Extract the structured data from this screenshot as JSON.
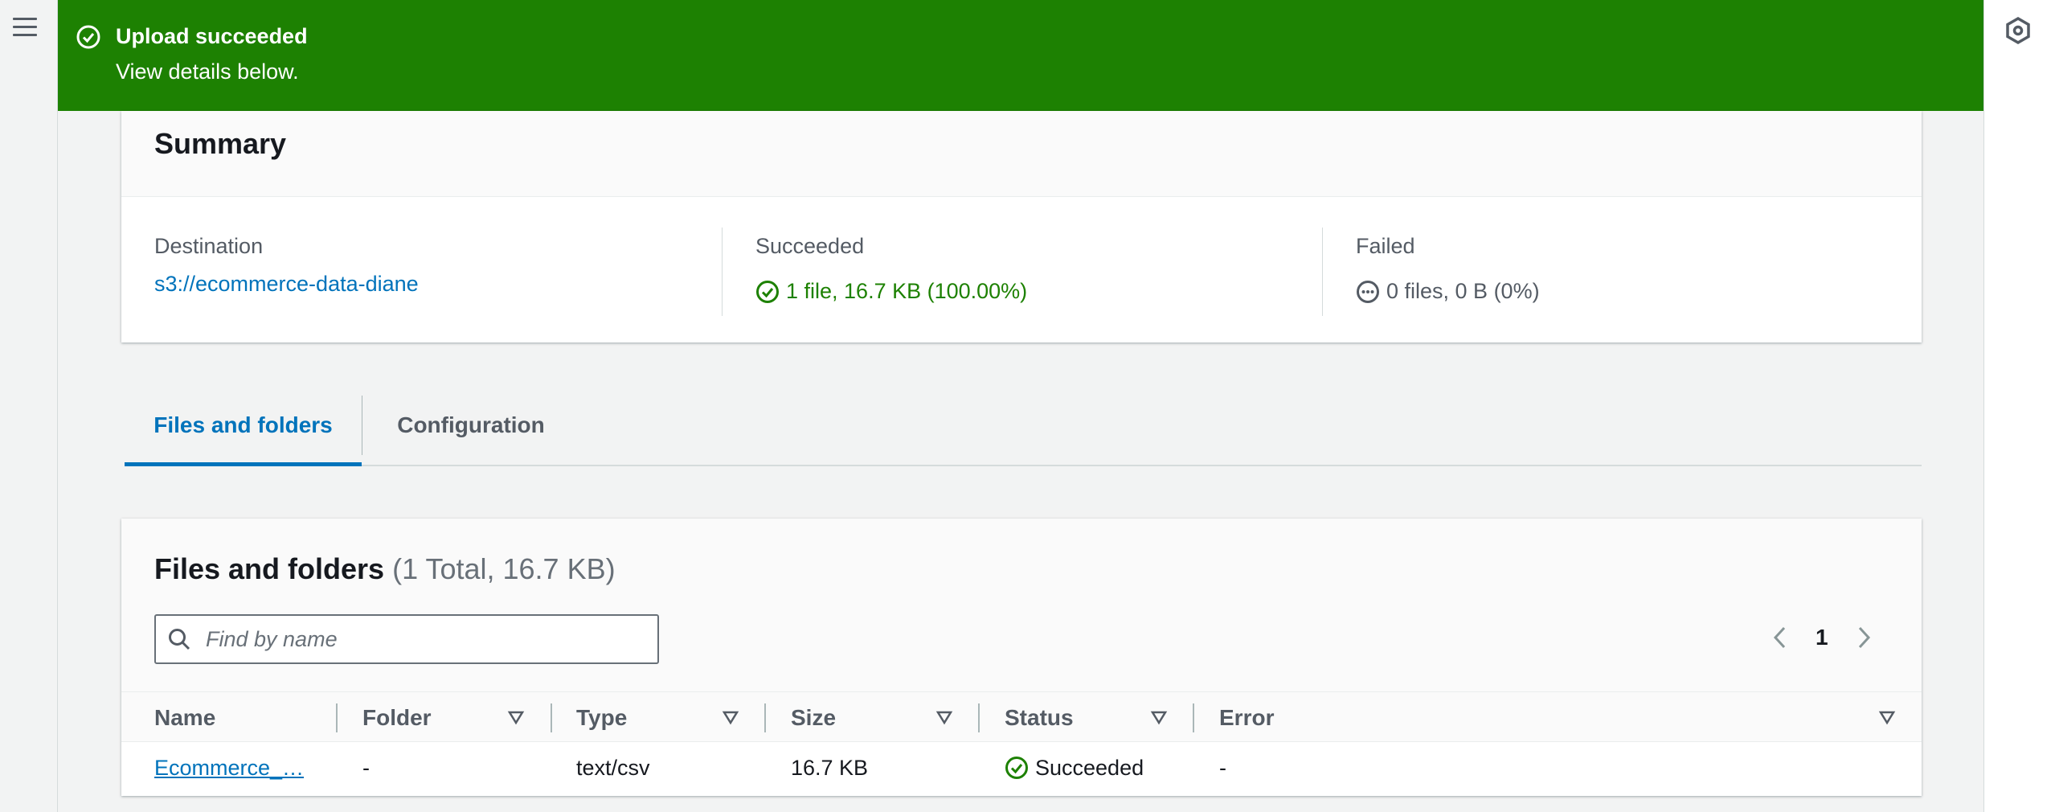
{
  "flash": {
    "title": "Upload succeeded",
    "subtitle": "View details below.",
    "icon": "check-circle-icon",
    "color": "#1d8102"
  },
  "summary": {
    "title": "Summary",
    "destination_label": "Destination",
    "destination_value": "s3://ecommerce-data-diane",
    "succeeded_label": "Succeeded",
    "succeeded_value": "1 file, 16.7 KB (100.00%)",
    "failed_label": "Failed",
    "failed_value": "0 files, 0 B (0%)"
  },
  "tabs": [
    {
      "label": "Files and folders",
      "active": true
    },
    {
      "label": "Configuration",
      "active": false
    }
  ],
  "files": {
    "title": "Files and folders",
    "count": "(1 Total, 16.7 KB)",
    "search_placeholder": "Find by name",
    "page": "1",
    "columns": [
      "Name",
      "Folder",
      "Type",
      "Size",
      "Status",
      "Error"
    ],
    "rows": [
      {
        "name": "Ecommerce_…",
        "folder": "-",
        "type": "text/csv",
        "size": "16.7 KB",
        "status": "Succeeded",
        "error": "-"
      }
    ]
  },
  "colors": {
    "accent": "#0073bb",
    "success": "#1d8102",
    "text": "#16191f",
    "muted": "#545b64"
  }
}
